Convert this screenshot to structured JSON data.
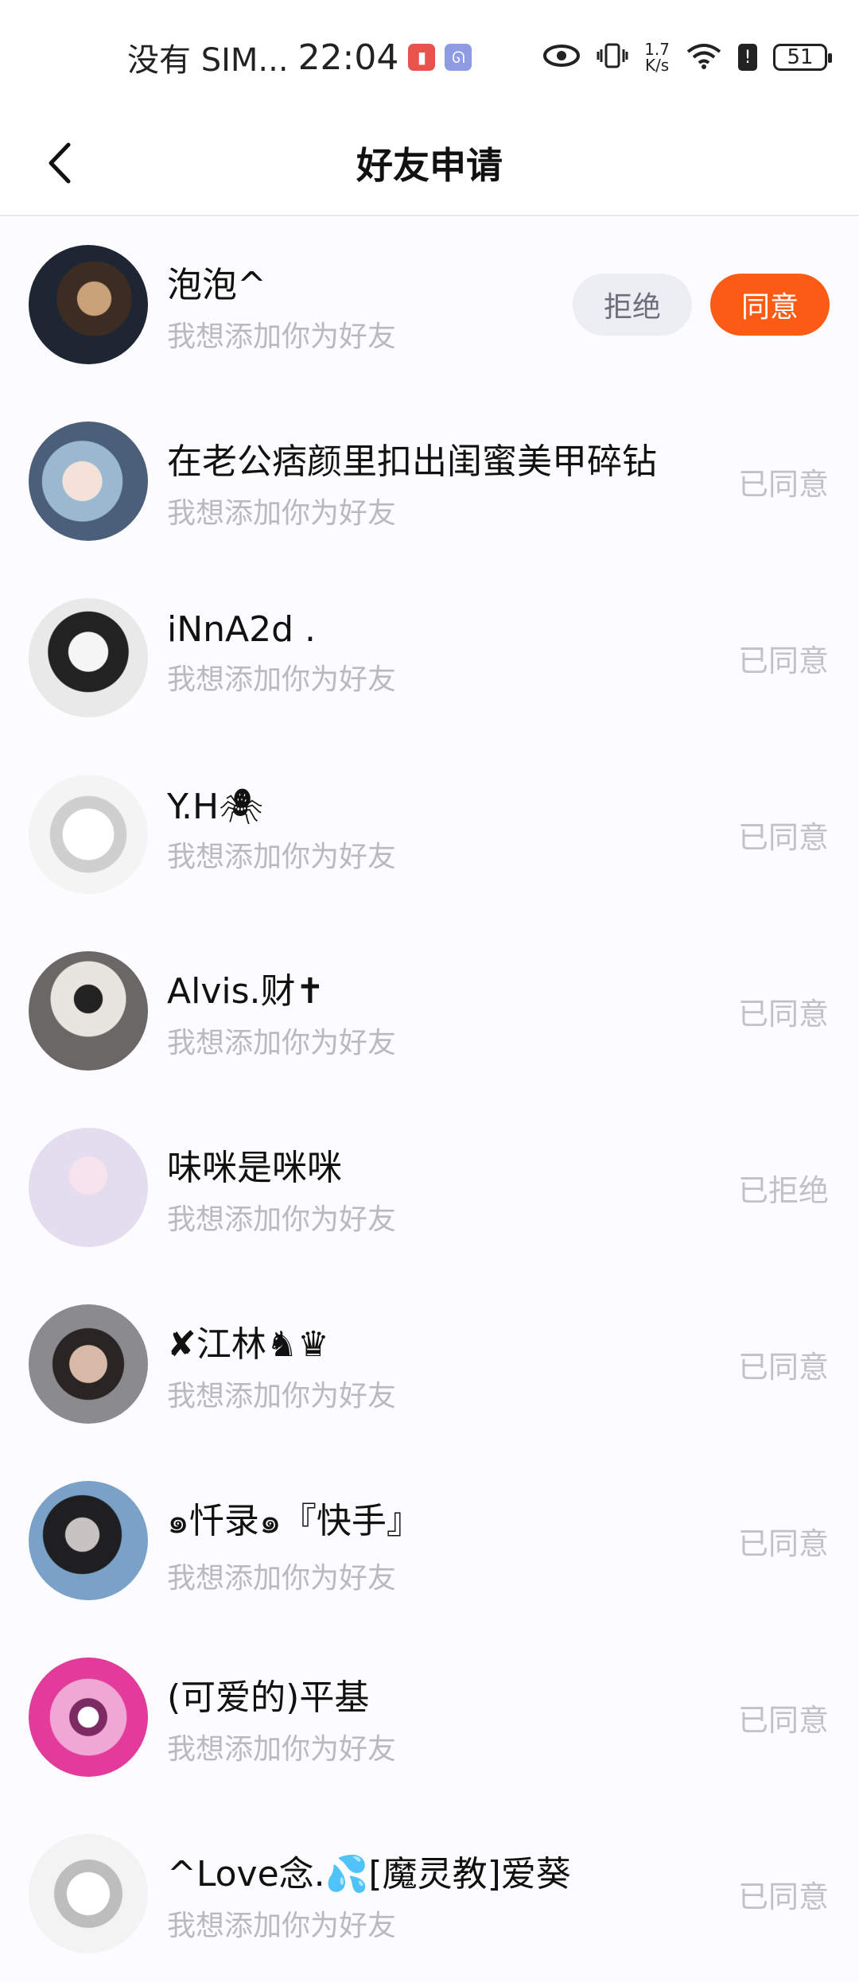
{
  "status_bar": {
    "carrier": "没有 SIM...",
    "time": "22:04",
    "speed_value": "1.7",
    "speed_unit": "K/s",
    "battery": "51"
  },
  "header": {
    "title": "好友申请"
  },
  "requests": [
    {
      "name": "泡泡^",
      "message": "我想添加你为好友",
      "reject_label": "拒绝",
      "accept_label": "同意"
    },
    {
      "name": "在老公痞颜里扣出闺蜜美甲碎钻",
      "message": "我想添加你为好友",
      "status": "已同意"
    },
    {
      "name": "iNnA2d .",
      "message": "我想添加你为好友",
      "status": "已同意"
    },
    {
      "name": "Y.H🕷",
      "message": "我想添加你为好友",
      "status": "已同意"
    },
    {
      "name": "Alvis.财✝",
      "message": "我想添加你为好友",
      "status": "已同意"
    },
    {
      "name": "味咪是咪咪",
      "message": "我想添加你为好友",
      "status": "已拒绝"
    },
    {
      "name": "✘江林♞♛",
      "message": "我想添加你为好友",
      "status": "已同意"
    },
    {
      "name": "๑忏录๑『快手』",
      "message": "我想添加你为好友",
      "status": "已同意"
    },
    {
      "name": "(可爱的)平基",
      "message": "我想添加你为好友",
      "status": "已同意"
    },
    {
      "name": "^Love念.💦[魔灵教]爱葵",
      "message": "我想添加你为好友",
      "status": "已同意"
    }
  ],
  "colors": {
    "accent": "#fb5b14",
    "reject_bg": "#eceef3",
    "muted_text": "#b9b9bf"
  }
}
